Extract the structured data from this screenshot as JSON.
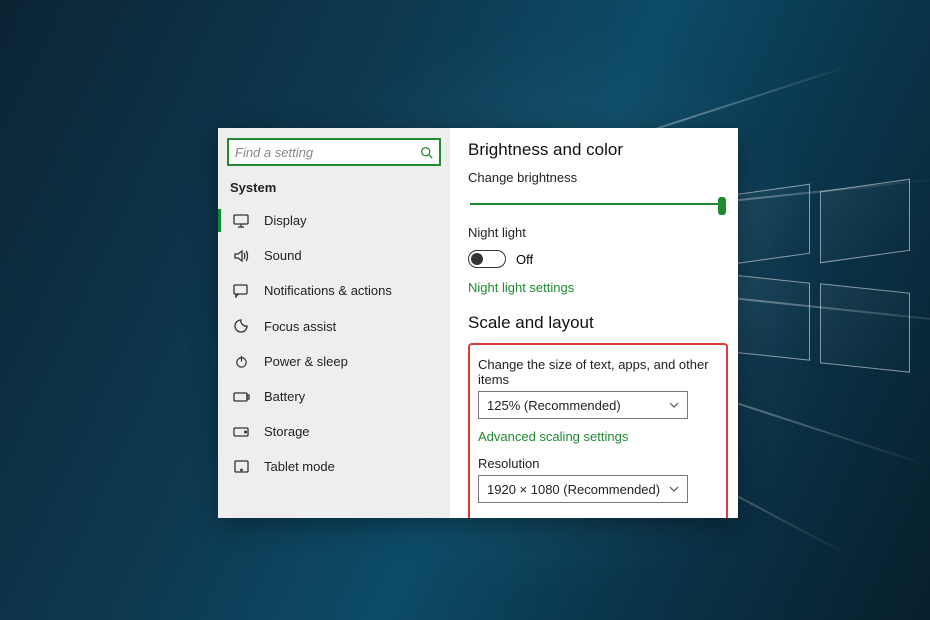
{
  "search": {
    "placeholder": "Find a setting"
  },
  "sidebar": {
    "title": "System",
    "items": [
      {
        "label": "Display"
      },
      {
        "label": "Sound"
      },
      {
        "label": "Notifications & actions"
      },
      {
        "label": "Focus assist"
      },
      {
        "label": "Power & sleep"
      },
      {
        "label": "Battery"
      },
      {
        "label": "Storage"
      },
      {
        "label": "Tablet mode"
      }
    ]
  },
  "content": {
    "brightness_heading": "Brightness and color",
    "brightness_label": "Change brightness",
    "nightlight_label": "Night light",
    "nightlight_state": "Off",
    "nightlight_link": "Night light settings",
    "scale_heading": "Scale and layout",
    "scale_label": "Change the size of text, apps, and other items",
    "scale_value": "125% (Recommended)",
    "advanced_link": "Advanced scaling settings",
    "resolution_label": "Resolution",
    "resolution_value": "1920 × 1080 (Recommended)"
  }
}
